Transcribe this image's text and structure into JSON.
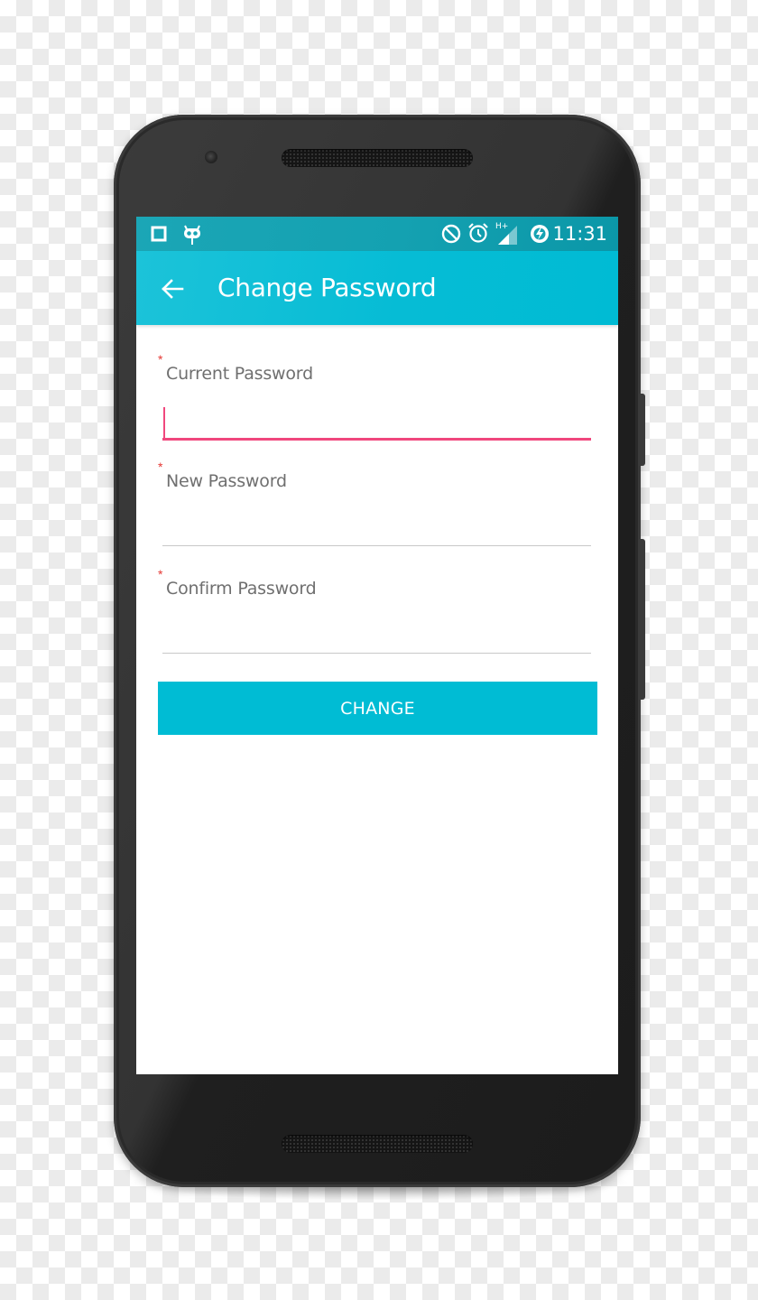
{
  "status_bar": {
    "left_icons": [
      "square-notification-icon",
      "cyanogenmod-icon"
    ],
    "right_icons": [
      "do-not-disturb-icon",
      "alarm-icon",
      "signal-hplus-icon",
      "battery-charging-icon"
    ],
    "network_type": "H+",
    "time": "11:31"
  },
  "app_bar": {
    "back_icon": "arrow-left-icon",
    "title": "Change Password"
  },
  "form": {
    "fields": [
      {
        "label": "Current Password",
        "required_marker": "*",
        "value": "",
        "focused": true
      },
      {
        "label": "New Password",
        "required_marker": "*",
        "value": "",
        "focused": false
      },
      {
        "label": "Confirm Password",
        "required_marker": "*",
        "value": "",
        "focused": false
      }
    ],
    "submit_label": "CHANGE"
  },
  "colors": {
    "primary": "#00bcd4",
    "status_bar": "#14a1b1",
    "accent": "#f0477d",
    "required": "#e53935"
  }
}
